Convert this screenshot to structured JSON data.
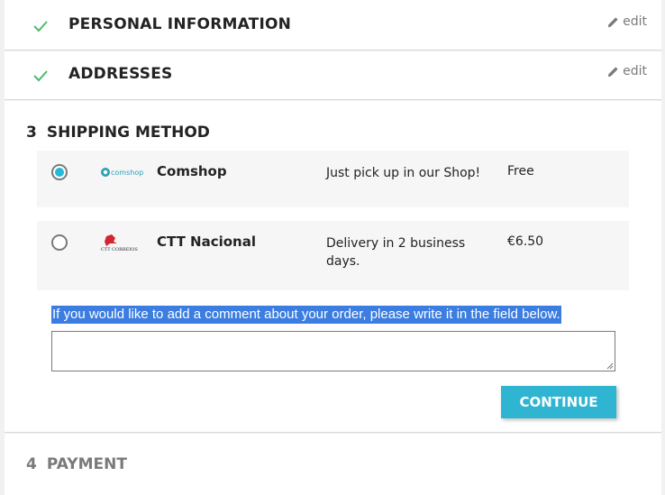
{
  "steps": {
    "personal": {
      "title": "Personal Information",
      "edit": "edit"
    },
    "addresses": {
      "title": "Addresses",
      "edit": "edit"
    },
    "shipping": {
      "number": "3",
      "title": "Shipping Method"
    },
    "payment": {
      "number": "4",
      "title": "Payment"
    }
  },
  "carriers": [
    {
      "name": "Comshop",
      "delay": "Just pick up in our Shop!",
      "price": "Free",
      "selected": true,
      "logo_text": "comshop"
    },
    {
      "name": "CTT Nacional",
      "delay": "Delivery in 2 business days.",
      "price": "€6.50",
      "selected": false,
      "logo_text": "CTT CORREIOS"
    }
  ],
  "comment": {
    "label": "If you would like to add a comment about your order, please write it in the field below.",
    "value": ""
  },
  "continue_label": "Continue",
  "colors": {
    "accent": "#2fb5d2",
    "check": "#4cbb6c",
    "selection": "#3b7de0"
  }
}
